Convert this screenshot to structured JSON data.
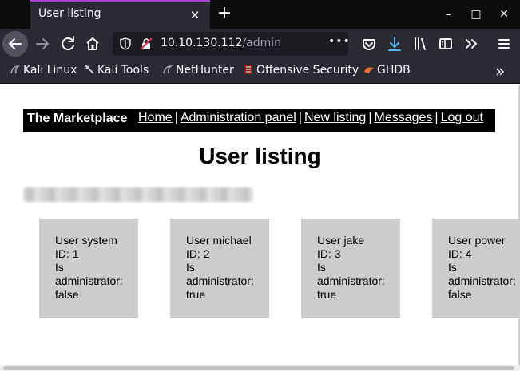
{
  "browser": {
    "tab_title": "User listing",
    "tab_close_glyph": "✕",
    "new_tab_glyph": "+",
    "window_controls": {
      "minimize": "–",
      "maximize": "□",
      "close": "✕"
    },
    "url_host": "10.10.130.112",
    "url_path": "/admin",
    "url_more": "•••",
    "bookmarks": [
      {
        "label": "Kali Linux",
        "icon": "kali-dragon-icon"
      },
      {
        "label": "Kali Tools",
        "icon": "kali-tools-icon"
      },
      {
        "label": "NetHunter",
        "icon": "kali-dragon-icon"
      },
      {
        "label": "Offensive Security",
        "icon": "offsec-icon"
      },
      {
        "label": "GHDB",
        "icon": "ghdb-icon"
      }
    ],
    "bookmarks_overflow": "»",
    "accent_color": "#b03ed8",
    "download_color": "#54b6f5"
  },
  "site": {
    "brand": "The Marketplace",
    "nav": [
      "Home",
      "Administration panel",
      "New listing",
      "Messages",
      "Log out"
    ],
    "separator": "|"
  },
  "heading": "User listing",
  "users": [
    {
      "line1": "User system",
      "line2": "ID: 1",
      "line3": "Is",
      "line4": "administrator:",
      "line5": "false"
    },
    {
      "line1": "User michael",
      "line2": "ID: 2",
      "line3": "Is",
      "line4": "administrator:",
      "line5": "true"
    },
    {
      "line1": "User jake",
      "line2": "ID: 3",
      "line3": "Is",
      "line4": "administrator:",
      "line5": "true"
    },
    {
      "line1": "User power",
      "line2": "ID: 4",
      "line3": "Is",
      "line4": "administrator:",
      "line5": "false"
    }
  ]
}
